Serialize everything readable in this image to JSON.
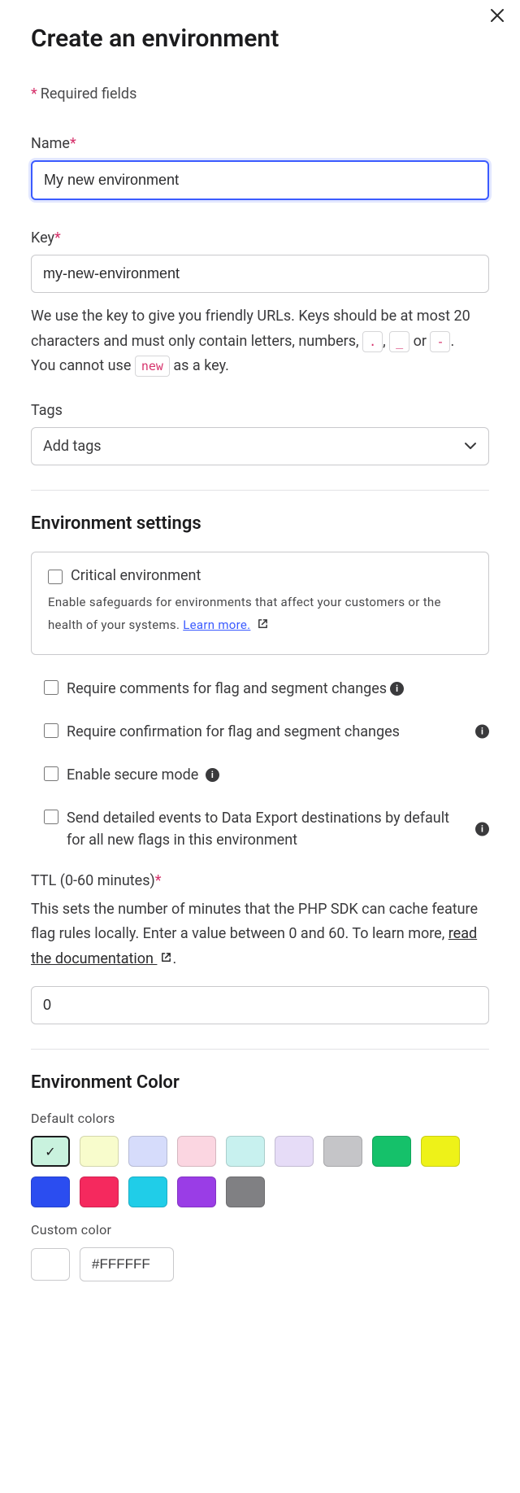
{
  "title": "Create an environment",
  "required_note": "Required fields",
  "name": {
    "label": "Name",
    "value": "My new environment"
  },
  "key": {
    "label": "Key",
    "value": "my-new-environment",
    "help_pre": "We use the key to give you friendly URLs. Keys should be at most 20 characters and must only contain letters, numbers, ",
    "chip1": ".",
    "sep1": ", ",
    "chip2": "_",
    "sep2": " or ",
    "chip3": "-",
    "help_post": ".",
    "cannot_pre": "You cannot use ",
    "cannot_chip": "new",
    "cannot_post": " as a key."
  },
  "tags": {
    "label": "Tags",
    "placeholder": "Add tags"
  },
  "env_settings_title": "Environment settings",
  "critical": {
    "label": "Critical environment",
    "desc": "Enable safeguards for environments that affect your customers or the health of your systems. ",
    "learn_more": "Learn more."
  },
  "settings": {
    "require_comments": "Require comments for flag and segment changes",
    "require_confirm": "Require confirmation for flag and segment changes",
    "secure_mode": "Enable secure mode",
    "detailed_events": "Send detailed events to Data Export destinations by default for all new flags in this environment"
  },
  "ttl": {
    "label": "TTL (0-60 minutes)",
    "desc_pre": "This sets the number of minutes that the PHP SDK can cache feature flag rules locally. Enter a value between 0 and 60. To learn more, ",
    "link": "read the documentation",
    "desc_post": ".",
    "value": "0"
  },
  "color": {
    "title": "Environment Color",
    "default_label": "Default colors",
    "custom_label": "Custom color",
    "hex_value": "#FFFFFF",
    "swatches": [
      {
        "hex": "#c9f2de",
        "selected": true
      },
      {
        "hex": "#f8fccc",
        "selected": false
      },
      {
        "hex": "#d6dcfb",
        "selected": false
      },
      {
        "hex": "#fbd6e1",
        "selected": false
      },
      {
        "hex": "#c8f1ef",
        "selected": false
      },
      {
        "hex": "#e6dcf7",
        "selected": false
      },
      {
        "hex": "#c5c5c8",
        "selected": false
      },
      {
        "hex": "#15c16a",
        "selected": false
      },
      {
        "hex": "#eef218",
        "selected": false
      },
      {
        "hex": "#2b4df0",
        "selected": false
      },
      {
        "hex": "#f5295e",
        "selected": false
      },
      {
        "hex": "#20cde8",
        "selected": false
      },
      {
        "hex": "#9a3de6",
        "selected": false
      },
      {
        "hex": "#808083",
        "selected": false
      }
    ]
  }
}
